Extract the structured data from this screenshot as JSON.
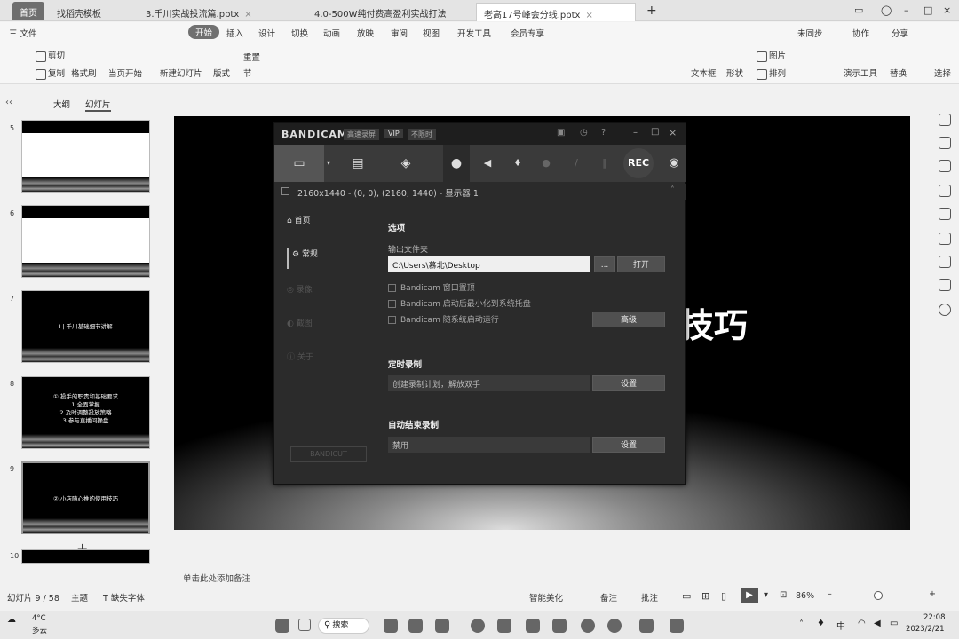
{
  "tabs": [
    {
      "label": "首页"
    },
    {
      "label": "找稻壳模板"
    },
    {
      "label": "3.千川实战投流篇.pptx"
    },
    {
      "label": "4.0-500W纯付费高盈利实战打法"
    },
    {
      "label": "老高17号峰会分线.pptx"
    }
  ],
  "menus": [
    "三 文件",
    "开始",
    "插入",
    "设计",
    "切换",
    "动画",
    "放映",
    "审阅",
    "视图",
    "开发工具",
    "会员专享"
  ],
  "menu_right": [
    "未同步",
    "协作",
    "分享"
  ],
  "ribbon": {
    "cut": "剪切",
    "copy": "复制",
    "format_brush": "格式刷",
    "from_current": "当页开始",
    "new_slide": "新建幻灯片",
    "layout": "版式",
    "section": "节",
    "reset": "重置",
    "textbox": "文本框",
    "shape": "形状",
    "picture": "图片",
    "arrange": "排列",
    "present_tools": "演示工具",
    "replace": "替换",
    "select": "选择"
  },
  "left_tabs": {
    "outline": "大纲",
    "slides": "幻灯片"
  },
  "thumbnails": [
    {
      "num": "5",
      "title": ""
    },
    {
      "num": "6",
      "title": ""
    },
    {
      "num": "7",
      "title": "I  |  千川基础细节讲解"
    },
    {
      "num": "8",
      "title": "①.投手的职责和基础要求\n1.全面掌握\n2.及时调整投放策略\n3.参与直播间操盘"
    },
    {
      "num": "9",
      "title": "②.小店随心推的使用技巧"
    },
    {
      "num": "10",
      "title": ""
    }
  ],
  "slide": {
    "big_text": "技巧"
  },
  "bandicam": {
    "logo": "BANDICAM",
    "badge1": "高速录屏",
    "badge2": "VIP",
    "badge3": "不限时",
    "rec": "REC",
    "resolution": "2160x1440 - (0, 0), (2160, 1440) - 显示器 1",
    "nav": [
      "首页",
      "常规",
      "录像",
      "截图",
      "关于"
    ],
    "options_title": "选项",
    "output_label": "输出文件夹",
    "output_path": "C:\\Users\\慕北\\Desktop",
    "dots": "...",
    "open": "打开",
    "chk1": "Bandicam 窗口置顶",
    "chk2": "Bandicam 启动后最小化到系统托盘",
    "chk3": "Bandicam 随系统启动运行",
    "advanced": "高级",
    "timer_title": "定时录制",
    "timer_text": "创建录制计划，解放双手",
    "settings": "设置",
    "autostop_title": "自动结束录制",
    "autostop_text": "禁用",
    "bottom_logo": "BANDICUT"
  },
  "notes": "单击此处添加备注",
  "status": {
    "slide_count": "幻灯片 9 / 58",
    "theme": "主题",
    "missing_font": "缺失字体",
    "beautify": "智能美化",
    "notes_btn": "备注",
    "comments": "批注",
    "zoom": "86%"
  },
  "taskbar": {
    "weather_temp": "4°C",
    "weather_desc": "多云",
    "search": "搜索",
    "ime": "中",
    "time": "22:08",
    "date": "2023/2/21"
  }
}
